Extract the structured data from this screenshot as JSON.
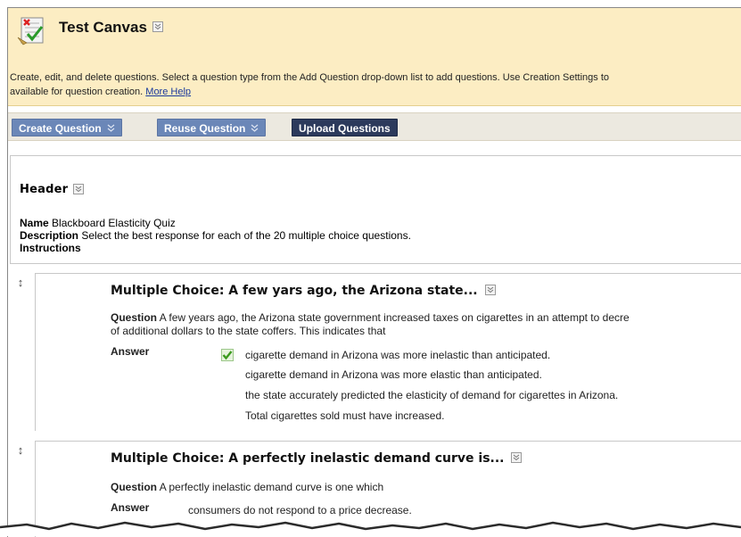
{
  "header": {
    "title": "Test Canvas",
    "intro_line1": "Create, edit, and delete questions. Select a question type from the Add Question drop-down list to add questions. Use Creation Settings to",
    "intro_line2": "available for question creation.",
    "more_help": "More Help"
  },
  "toolbar": {
    "create_label": "Create Question",
    "reuse_label": "Reuse Question",
    "upload_label": "Upload Questions"
  },
  "test_header": {
    "title": "Header",
    "name_label": "Name",
    "name_value": "Blackboard Elasticity Quiz",
    "description_label": "Description",
    "description_value": "Select the best response for each of the 20 multiple choice questions.",
    "instructions_label": "Instructions"
  },
  "questions": [
    {
      "title": "Multiple Choice: A few yars ago, the Arizona state...",
      "question_label": "Question",
      "question_line1": "A few years ago, the Arizona state government increased taxes on cigarettes in an attempt to decre",
      "question_line2": "of additional dollars to the state coffers. This indicates that",
      "answer_label": "Answer",
      "answers": [
        "cigarette demand in Arizona was more inelastic than anticipated.",
        "cigarette demand in Arizona was more elastic than anticipated.",
        "the state accurately predicted the elasticity of demand for cigarettes in Arizona.",
        "Total cigarettes sold must have increased."
      ],
      "correct_index": 0
    },
    {
      "title": "Multiple Choice: A perfectly inelastic demand curve is...",
      "question_label": "Question",
      "question_line1": "A perfectly inelastic demand curve is one which",
      "answer_label": "Answer",
      "answers": [
        "consumers do not respond to a price decrease."
      ]
    }
  ],
  "colors": {
    "band": "#fcedc3",
    "button_blue": "#6b87b8",
    "button_dark": "#2c3a5c",
    "check_green": "#4caf2a"
  },
  "icons": [
    "test-canvas-icon",
    "chevron-down-icon",
    "drag-handle-icon",
    "correct-check-icon"
  ]
}
